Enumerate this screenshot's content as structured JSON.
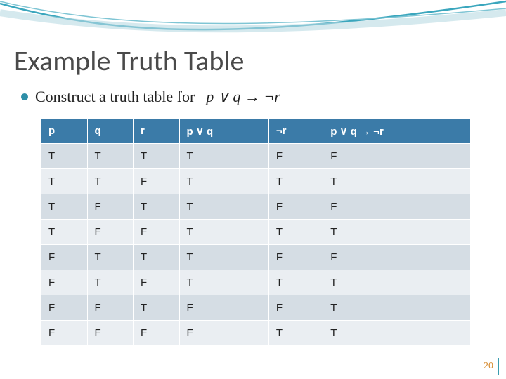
{
  "title": "Example Truth Table",
  "bullet": "Construct a truth table for",
  "formula": "p ∨ q → ¬r",
  "page_number": "20",
  "chart_data": {
    "type": "table",
    "headers": [
      "p",
      "q",
      "r",
      "p ∨ q",
      "¬r",
      "p ∨ q → ¬r"
    ],
    "rows": [
      [
        "T",
        "T",
        "T",
        "T",
        "F",
        "F"
      ],
      [
        "T",
        "T",
        "F",
        "T",
        "T",
        "T"
      ],
      [
        "T",
        "F",
        "T",
        "T",
        "F",
        "F"
      ],
      [
        "T",
        "F",
        "F",
        "T",
        "T",
        "T"
      ],
      [
        "F",
        "T",
        "T",
        "T",
        "F",
        "F"
      ],
      [
        "F",
        "T",
        "F",
        "T",
        "T",
        "T"
      ],
      [
        "F",
        "F",
        "T",
        "F",
        "F",
        "T"
      ],
      [
        "F",
        "F",
        "F",
        "F",
        "T",
        "T"
      ]
    ]
  }
}
